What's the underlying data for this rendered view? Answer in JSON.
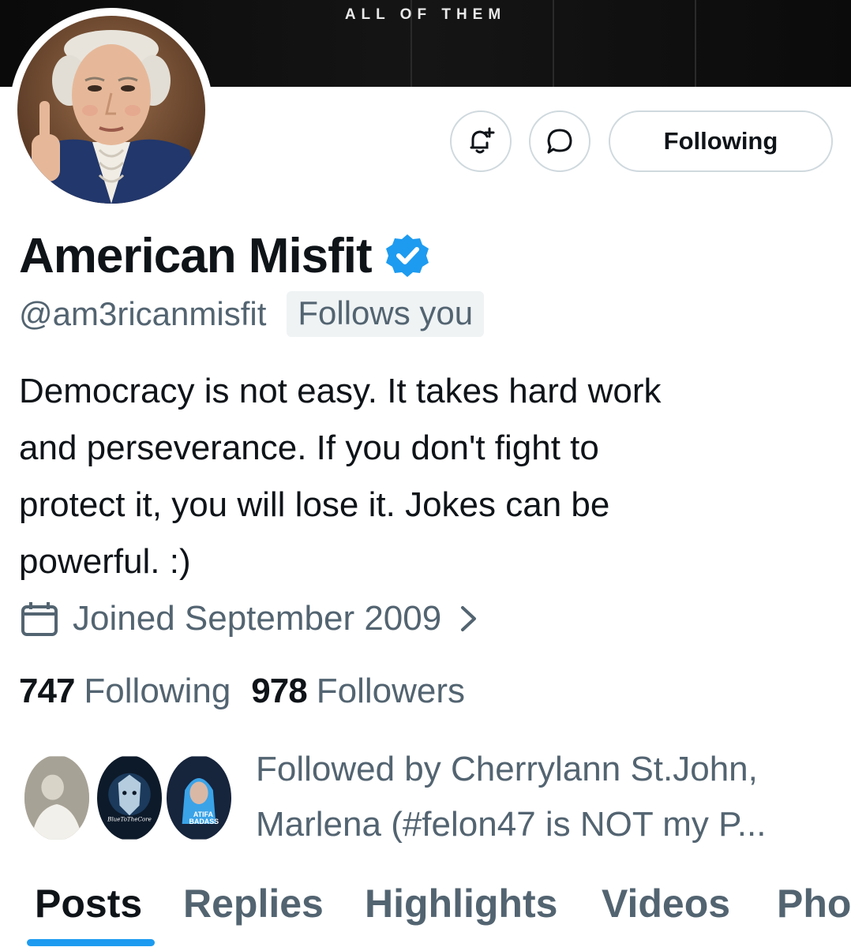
{
  "banner": {
    "text": "ALL OF THEM"
  },
  "actions": {
    "following_label": "Following"
  },
  "profile": {
    "name": "American Misfit",
    "handle": "@am3ricanmisfit",
    "follows_you": "Follows you",
    "bio_lines": [
      "Democracy is not easy. It takes hard work",
      "and perseverance. If you don't fight to",
      "protect it, you will lose it. Jokes can be",
      "powerful. :)"
    ],
    "joined": "Joined September 2009",
    "following_count": "747",
    "following_label": "Following",
    "followers_count": "978",
    "followers_label": "Followers",
    "followed_by_lines": [
      "Followed by Cherrylann St.John,",
      "Marlena (#felon47 is NOT my P..."
    ],
    "follower_avatar_captions": [
      "BlueToTheCore",
      "ATIFA",
      "BADASS"
    ]
  },
  "tabs": [
    "Posts",
    "Replies",
    "Highlights",
    "Videos",
    "Pho"
  ],
  "colors": {
    "accent": "#1d9bf0",
    "muted": "#536471",
    "text": "#0f1419",
    "border": "#cfd9de"
  },
  "icons": [
    "bell-plus-icon",
    "message-icon",
    "verified-badge-icon",
    "calendar-icon",
    "chevron-right-icon"
  ]
}
